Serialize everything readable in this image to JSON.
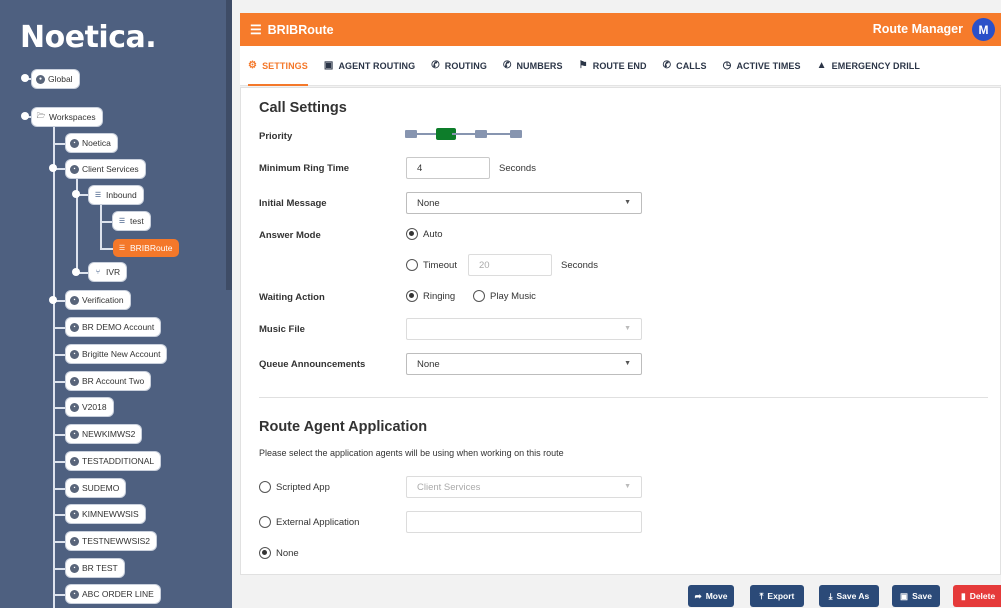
{
  "brand": {
    "logo": "Noetica."
  },
  "tree": {
    "global": "Global",
    "workspaces": "Workspaces",
    "noetica": "Noetica",
    "client_services": "Client Services",
    "inbound": "Inbound",
    "test": "test",
    "bribroute": "BRIBRoute",
    "ivr": "IVR",
    "verification": "Verification",
    "accounts": [
      "BR DEMO Account",
      "Brigitte New Account",
      "BR Account Two",
      "V2018",
      "NEWKIMWS2",
      "TESTADDITIONAL",
      "SUDEMO",
      "KIMNEWWSIS",
      "TESTNEWWSIS2",
      "BR TEST",
      "ABC ORDER LINE"
    ]
  },
  "header": {
    "app_title": "BRIBRoute",
    "manager": "Route Manager",
    "avatar": "M"
  },
  "tabs": [
    "SETTINGS",
    "AGENT ROUTING",
    "ROUTING",
    "NUMBERS",
    "ROUTE END",
    "CALLS",
    "ACTIVE TIMES",
    "EMERGENCY DRILL"
  ],
  "call_settings": {
    "title": "Call Settings",
    "priority_label": "Priority",
    "priority": {
      "steps": 4,
      "selected": 2
    },
    "min_ring_label": "Minimum Ring Time",
    "min_ring_value": "4",
    "min_ring_unit": "Seconds",
    "initial_message_label": "Initial Message",
    "initial_message_value": "None",
    "answer_mode_label": "Answer Mode",
    "answer_auto": "Auto",
    "answer_timeout": "Timeout",
    "timeout_value": "20",
    "timeout_unit": "Seconds",
    "waiting_action_label": "Waiting Action",
    "waiting_ringing": "Ringing",
    "waiting_music": "Play Music",
    "music_file_label": "Music File",
    "music_file_value": "",
    "queue_label": "Queue Announcements",
    "queue_value": "None"
  },
  "agent_app": {
    "title": "Route Agent Application",
    "description": "Please select the application agents will be using when working on this route",
    "scripted_app": "Scripted App",
    "scripted_value": "Client Services",
    "external_app": "External Application",
    "external_value": "",
    "none": "None"
  },
  "footer": {
    "move": "Move",
    "export": "Export",
    "save_as": "Save As",
    "save": "Save",
    "delete": "Delete"
  },
  "colors": {
    "accent": "#f67b2b",
    "sidebar": "#4e6080",
    "priority_selected": "#0d7d2a",
    "danger": "#e53a3a",
    "button": "#2b4a78"
  }
}
